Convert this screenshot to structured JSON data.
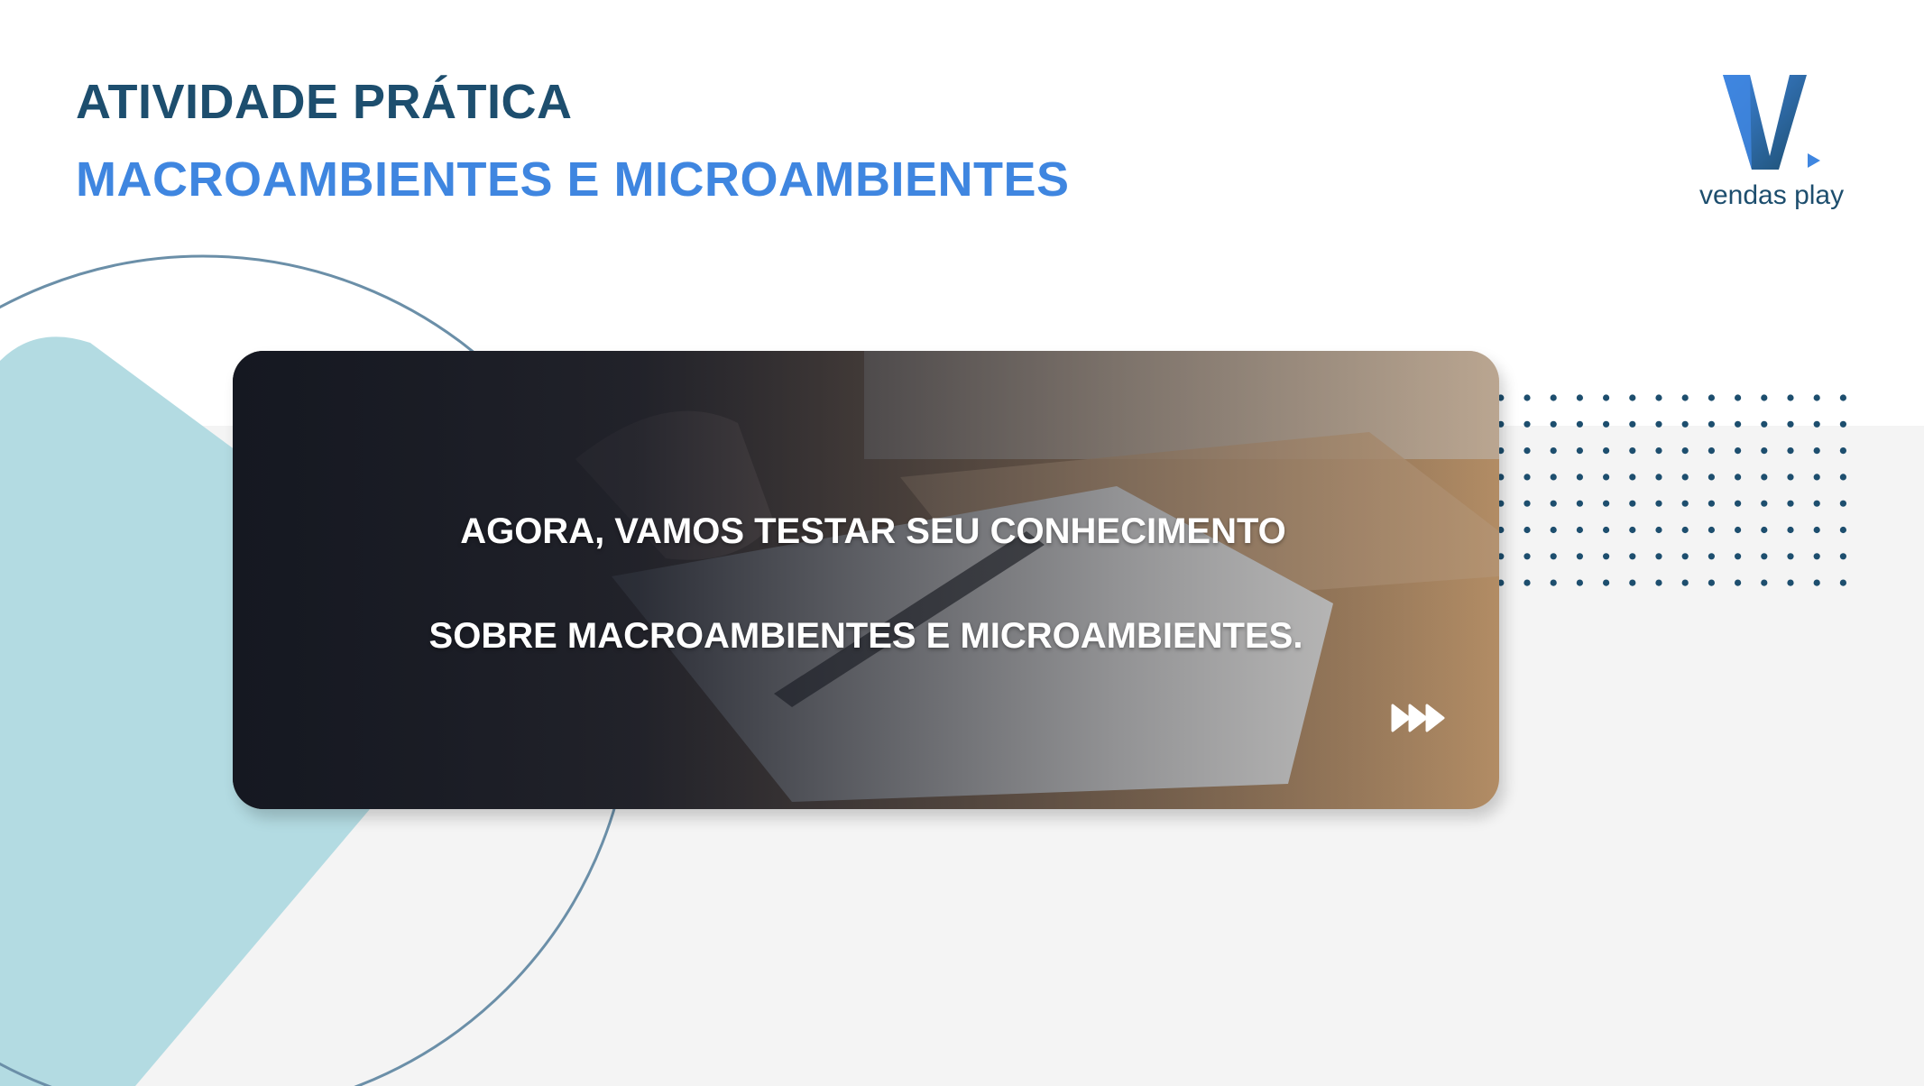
{
  "header": {
    "title_line_1": "ATIVIDADE PRÁTICA",
    "title_line_2": "MACROAMBIENTES E MICROAMBIENTES"
  },
  "logo": {
    "text": "vendas play",
    "icon": "vendas-play-v-logo"
  },
  "card": {
    "line_1": "AGORA, VAMOS TESTAR SEU CONHECIMENTO",
    "line_2": "SOBRE MACROAMBIENTES E MICROAMBIENTES.",
    "next_icon": "fast-forward-icon"
  },
  "colors": {
    "primary_dark": "#1d4e6e",
    "accent_blue": "#3f86e0",
    "light_teal": "#b3dbe2",
    "dot_color": "#1d4e6e",
    "background_band": "#f4f4f4"
  }
}
